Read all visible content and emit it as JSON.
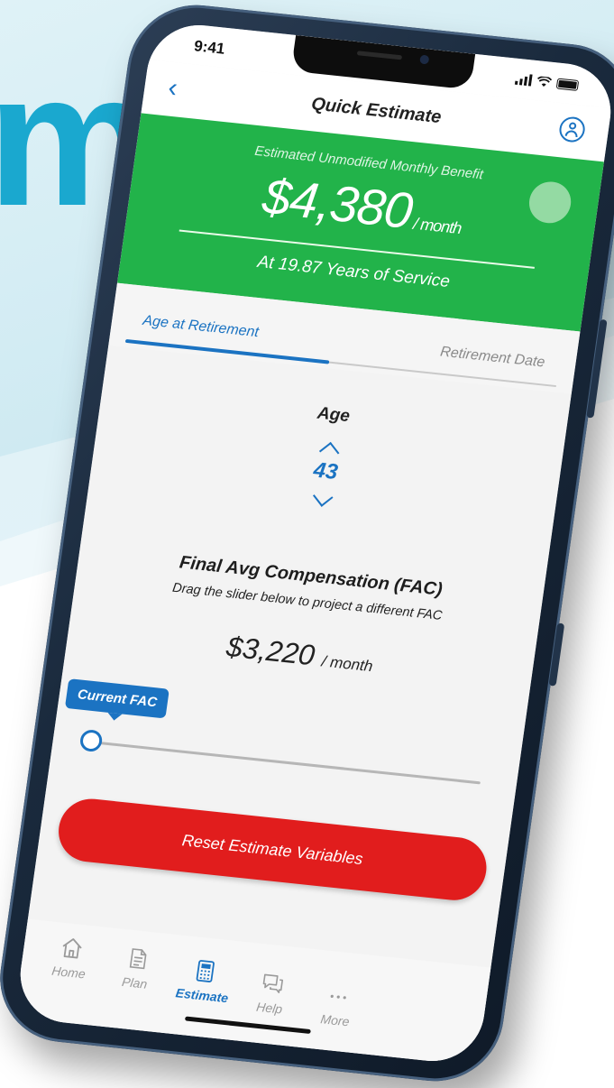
{
  "background": {
    "hero_letter": "m"
  },
  "status_bar": {
    "time": "9:41"
  },
  "nav": {
    "title": "Quick Estimate"
  },
  "benefit": {
    "label": "Estimated Unmodified Monthly Benefit",
    "amount": "$4,380",
    "unit": "/ month",
    "service": "At 19.87 Years of Service"
  },
  "tabs": [
    {
      "label": "Age at Retirement",
      "active": true
    },
    {
      "label": "Retirement Date",
      "active": false
    }
  ],
  "age": {
    "label": "Age",
    "value": "43"
  },
  "fac": {
    "title": "Final Avg Compensation (FAC)",
    "description": "Drag the slider below to project a different FAC",
    "amount": "$3,220",
    "unit": "/ month",
    "tooltip": "Current FAC",
    "slider_position": 0
  },
  "reset_button": {
    "label": "Reset Estimate Variables"
  },
  "tab_bar": {
    "items": [
      {
        "label": "Home",
        "icon": "home-icon"
      },
      {
        "label": "Plan",
        "icon": "document-icon"
      },
      {
        "label": "Estimate",
        "icon": "calculator-icon",
        "active": true
      },
      {
        "label": "Help",
        "icon": "chat-icon"
      },
      {
        "label": "More",
        "icon": "more-icon"
      }
    ]
  },
  "colors": {
    "brand_blue": "#1b73c2",
    "benefit_green": "#22b34a",
    "reset_red": "#e11d1d",
    "hero_cyan": "#1aa8cf"
  }
}
